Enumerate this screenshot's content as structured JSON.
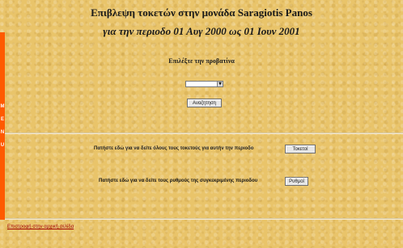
{
  "menu": {
    "letters": [
      "M",
      "E",
      "N",
      "U"
    ],
    "strip_color": "#ff5a00"
  },
  "header": {
    "title": "Επιβλεψη τοκετών στην μονάδα Saragiotis Panos",
    "period": "για την περιοδο 01 Αυγ 2000 ως 01 Ιουν 2001"
  },
  "selection": {
    "label": "Επιλέξτε την προβατίνα",
    "selected_value": "",
    "search_button": "Αναζητηση"
  },
  "rows": {
    "births_text": "Πατήστε εδώ για να δείτε όλους τους τοκετούς για αυτήν την περιοδο",
    "births_button": "Τοκετοί",
    "rates_text": "Πατήστε εδώ για να δείτε τους ρυθμούς της συγκεκριμένης περιοδου",
    "rates_button": "Ρυθμοί"
  },
  "footer": {
    "back_link": "Επιστροφή στην αρχική σελίδα"
  },
  "colors": {
    "background": "#e9c46a",
    "link": "#a00000"
  }
}
